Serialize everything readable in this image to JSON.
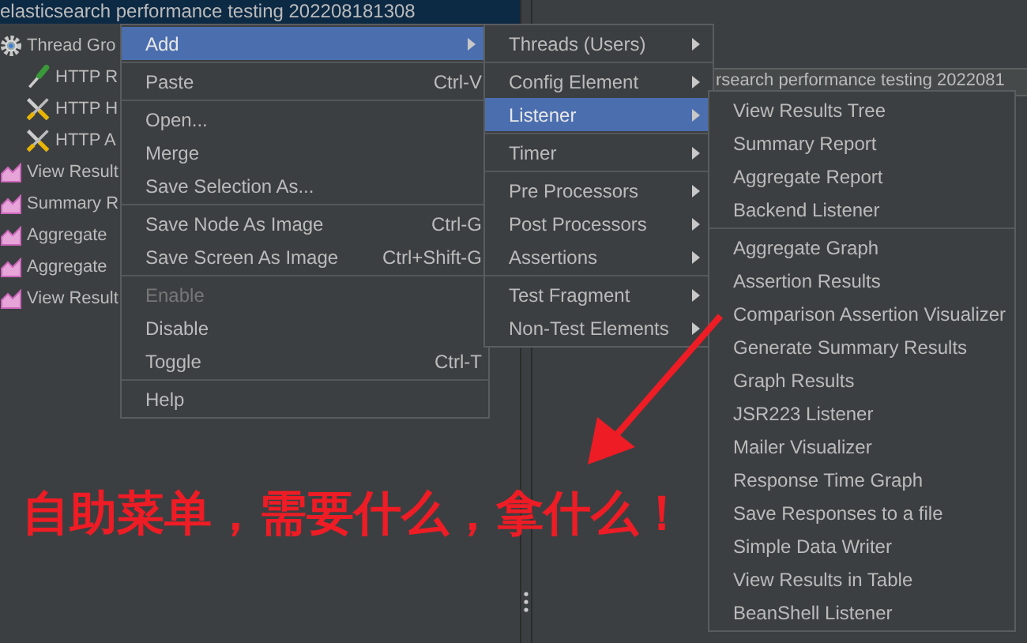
{
  "tree": [
    {
      "label": "elasticsearch performance testing 202208181308",
      "selected": true,
      "children": [
        {
          "label": "Thread Gro",
          "kind": "gear",
          "selected": false,
          "children": [
            {
              "label": "HTTP R",
              "kind": "dropper",
              "selected": false
            },
            {
              "label": "HTTP H",
              "kind": "tools",
              "selected": false
            },
            {
              "label": "HTTP A",
              "kind": "tools",
              "selected": false
            }
          ]
        },
        {
          "label": "View Result",
          "kind": "chart",
          "selected": false
        },
        {
          "label": "Summary R",
          "kind": "chart",
          "selected": false
        },
        {
          "label": "Aggregate",
          "kind": "chart",
          "selected": false
        },
        {
          "label": "Aggregate",
          "kind": "chart",
          "selected": false
        },
        {
          "label": "View Result",
          "kind": "chart",
          "selected": false
        }
      ]
    }
  ],
  "right_panel": {
    "name_field": "rsearch performance testing 2022081"
  },
  "context_menu": {
    "groups": [
      [
        {
          "label": "Add",
          "submenu": true,
          "selected": true,
          "disabled": false
        }
      ],
      [
        {
          "label": "Paste",
          "shortcut": "Ctrl-V",
          "submenu": false,
          "selected": false,
          "disabled": false
        }
      ],
      [
        {
          "label": "Open...",
          "submenu": false,
          "selected": false,
          "disabled": false
        },
        {
          "label": "Merge",
          "submenu": false,
          "selected": false,
          "disabled": false
        },
        {
          "label": "Save Selection As...",
          "submenu": false,
          "selected": false,
          "disabled": false
        }
      ],
      [
        {
          "label": "Save Node As Image",
          "shortcut": "Ctrl-G",
          "submenu": false,
          "selected": false,
          "disabled": false
        },
        {
          "label": "Save Screen As Image",
          "shortcut": "Ctrl+Shift-G",
          "submenu": false,
          "selected": false,
          "disabled": false
        }
      ],
      [
        {
          "label": "Enable",
          "submenu": false,
          "selected": false,
          "disabled": true
        },
        {
          "label": "Disable",
          "submenu": false,
          "selected": false,
          "disabled": false
        },
        {
          "label": "Toggle",
          "shortcut": "Ctrl-T",
          "submenu": false,
          "selected": false,
          "disabled": false
        }
      ],
      [
        {
          "label": "Help",
          "submenu": false,
          "selected": false,
          "disabled": false
        }
      ]
    ]
  },
  "add_submenu": {
    "groups": [
      [
        {
          "label": "Threads (Users)",
          "submenu": true,
          "selected": false,
          "disabled": false
        }
      ],
      [
        {
          "label": "Config Element",
          "submenu": true,
          "selected": false,
          "disabled": false
        },
        {
          "label": "Listener",
          "submenu": true,
          "selected": true,
          "disabled": false
        }
      ],
      [
        {
          "label": "Timer",
          "submenu": true,
          "selected": false,
          "disabled": false
        }
      ],
      [
        {
          "label": "Pre Processors",
          "submenu": true,
          "selected": false,
          "disabled": false
        },
        {
          "label": "Post Processors",
          "submenu": true,
          "selected": false,
          "disabled": false
        },
        {
          "label": "Assertions",
          "submenu": true,
          "selected": false,
          "disabled": false
        }
      ],
      [
        {
          "label": "Test Fragment",
          "submenu": true,
          "selected": false,
          "disabled": false
        },
        {
          "label": "Non-Test Elements",
          "submenu": true,
          "selected": false,
          "disabled": false
        }
      ]
    ]
  },
  "listener_submenu": {
    "groups": [
      [
        {
          "label": "View Results Tree",
          "selected": false,
          "disabled": false
        },
        {
          "label": "Summary Report",
          "selected": false,
          "disabled": false
        },
        {
          "label": "Aggregate Report",
          "selected": false,
          "disabled": false
        },
        {
          "label": "Backend Listener",
          "selected": false,
          "disabled": false
        }
      ],
      [
        {
          "label": "Aggregate Graph",
          "selected": false,
          "disabled": false
        },
        {
          "label": "Assertion Results",
          "selected": false,
          "disabled": false
        },
        {
          "label": "Comparison Assertion Visualizer",
          "selected": false,
          "disabled": false
        },
        {
          "label": "Generate Summary Results",
          "selected": false,
          "disabled": false
        },
        {
          "label": "Graph Results",
          "selected": false,
          "disabled": false
        },
        {
          "label": "JSR223 Listener",
          "selected": false,
          "disabled": false
        },
        {
          "label": "Mailer Visualizer",
          "selected": false,
          "disabled": false
        },
        {
          "label": "Response Time Graph",
          "selected": false,
          "disabled": false
        },
        {
          "label": "Save Responses to a file",
          "selected": false,
          "disabled": false
        },
        {
          "label": "Simple Data Writer",
          "selected": false,
          "disabled": false
        },
        {
          "label": "View Results in Table",
          "selected": false,
          "disabled": false
        },
        {
          "label": "BeanShell Listener",
          "selected": false,
          "disabled": false
        }
      ]
    ]
  },
  "annotation": {
    "text": "自助菜单，需要什么，拿什么！"
  }
}
